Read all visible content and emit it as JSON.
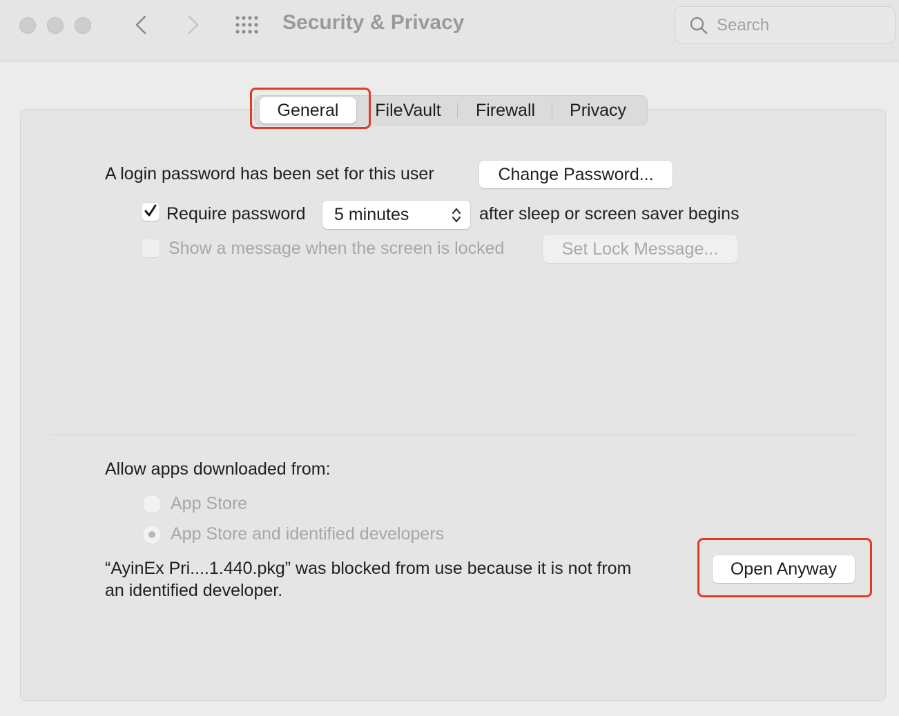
{
  "window": {
    "title": "Security & Privacy",
    "search_placeholder": "Search"
  },
  "tabs": [
    {
      "label": "General",
      "selected": true
    },
    {
      "label": "FileVault",
      "selected": false
    },
    {
      "label": "Firewall",
      "selected": false
    },
    {
      "label": "Privacy",
      "selected": false
    }
  ],
  "general": {
    "login_text": "A login password has been set for this user",
    "change_password_label": "Change Password...",
    "require_password": {
      "label": "Require password",
      "checked": true
    },
    "require_delay": "5 minutes",
    "after_text": "after sleep or screen saver begins",
    "show_message": {
      "label": "Show a message when the screen is locked",
      "checked": false,
      "enabled": false
    },
    "set_lock_message_label": "Set Lock Message..."
  },
  "allow_apps": {
    "heading": "Allow apps downloaded from:",
    "options": [
      {
        "label": "App Store",
        "selected": false,
        "enabled": false
      },
      {
        "label": "App Store and identified developers",
        "selected": true,
        "enabled": false
      }
    ],
    "blocked_line1": "“AyinEx Pri....1.440.pkg” was blocked from use because it is not from",
    "blocked_line2": "an identified developer.",
    "open_anyway_label": "Open Anyway"
  },
  "colors": {
    "annotation": "#e23a22",
    "window_bg": "#ececed"
  }
}
